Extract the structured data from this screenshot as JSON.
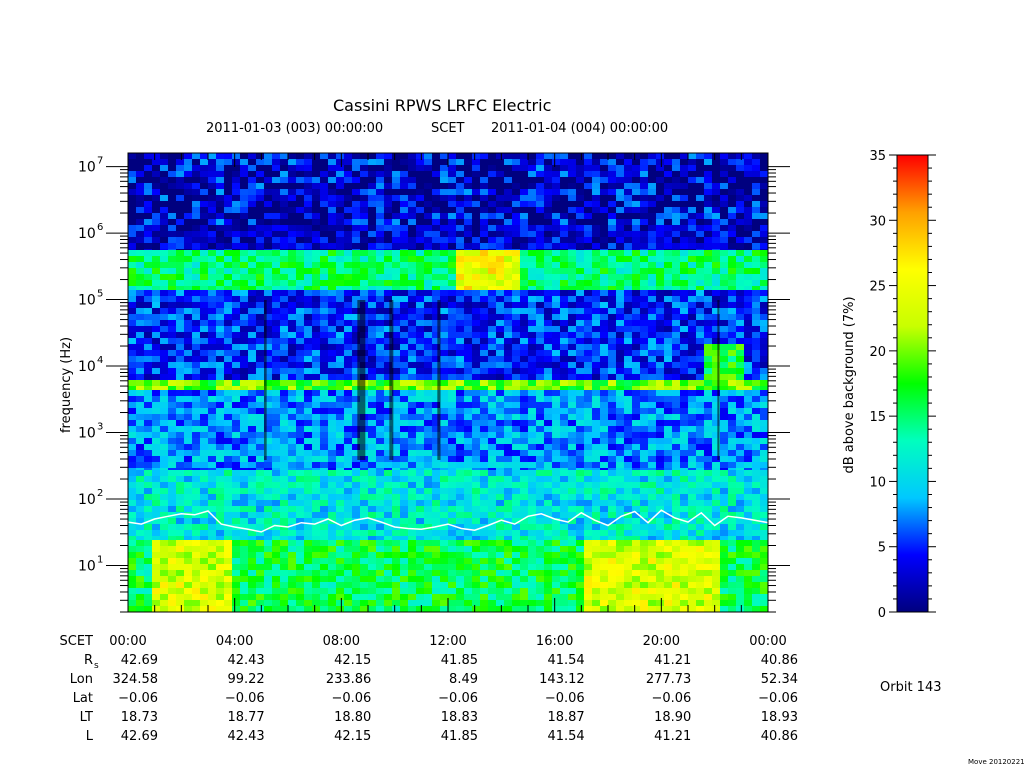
{
  "chart_data": {
    "type": "heatmap",
    "title": "Cassini RPWS LRFC Electric",
    "subtitle": {
      "start": "2011-01-03 (003) 00:00:00",
      "mid": "SCET",
      "end": "2011-01-04 (004) 00:00:00"
    },
    "ylabel": "frequency (Hz)",
    "y_scale": "log",
    "ylim": [
      2,
      16000000
    ],
    "y_ticks": [
      {
        "base": "10",
        "exp": "7",
        "value": 10000000
      },
      {
        "base": "10",
        "exp": "6",
        "value": 1000000
      },
      {
        "base": "10",
        "exp": "5",
        "value": 100000
      },
      {
        "base": "10",
        "exp": "4",
        "value": 10000
      },
      {
        "base": "10",
        "exp": "3",
        "value": 1000
      },
      {
        "base": "10",
        "exp": "2",
        "value": 100
      },
      {
        "base": "10",
        "exp": "1",
        "value": 10
      }
    ],
    "x_ticks": [
      "00:00",
      "04:00",
      "08:00",
      "12:00",
      "16:00",
      "20:00",
      "00:00"
    ],
    "colorbar": {
      "label": "dB above background (7%)",
      "range": [
        0,
        35
      ],
      "ticks": [
        "35",
        "30",
        "25",
        "20",
        "15",
        "10",
        "5",
        "0"
      ],
      "colors": [
        "#00007f",
        "#0000ff",
        "#00c8ff",
        "#00ffbe",
        "#00ff00",
        "#c8ff00",
        "#ffff00",
        "#ffa000",
        "#ff0000"
      ]
    },
    "ephemeris": {
      "labels": [
        "SCET",
        "R",
        "Lon",
        "Lat",
        "LT",
        "L"
      ],
      "r_subscript": "s",
      "rows": [
        [
          "42.69",
          "42.43",
          "42.15",
          "41.85",
          "41.54",
          "41.21",
          "40.86"
        ],
        [
          "324.58",
          "99.22",
          "233.86",
          "8.49",
          "143.12",
          "277.73",
          "52.34"
        ],
        [
          "−0.06",
          "−0.06",
          "−0.06",
          "−0.06",
          "−0.06",
          "−0.06",
          "−0.06"
        ],
        [
          "18.73",
          "18.77",
          "18.80",
          "18.83",
          "18.87",
          "18.90",
          "18.93"
        ],
        [
          "42.69",
          "42.43",
          "42.15",
          "41.85",
          "41.54",
          "41.21",
          "40.86"
        ]
      ]
    },
    "electron_cyclotron_line": {
      "color": "#ffffff",
      "x_hours": [
        0,
        0.5,
        1,
        1.5,
        2,
        2.5,
        3,
        3.5,
        4,
        4.5,
        5,
        5.5,
        6,
        6.5,
        7,
        7.5,
        8,
        8.5,
        9,
        9.5,
        10,
        10.5,
        11,
        11.5,
        12,
        12.5,
        13,
        13.5,
        14,
        14.5,
        15,
        15.5,
        16,
        16.5,
        17,
        17.5,
        18,
        18.5,
        19,
        19.5,
        20,
        20.5,
        21,
        21.5,
        22,
        22.5,
        23,
        23.5,
        24
      ],
      "y_hz": [
        45,
        42,
        50,
        55,
        60,
        58,
        66,
        42,
        38,
        35,
        32,
        40,
        38,
        44,
        42,
        50,
        40,
        48,
        52,
        45,
        38,
        36,
        35,
        38,
        42,
        36,
        34,
        40,
        48,
        42,
        55,
        60,
        50,
        45,
        62,
        48,
        40,
        55,
        65,
        44,
        68,
        52,
        45,
        62,
        40,
        55,
        52,
        48,
        44
      ]
    }
  },
  "orbit": "Orbit 143",
  "footer": "Move 20120221"
}
